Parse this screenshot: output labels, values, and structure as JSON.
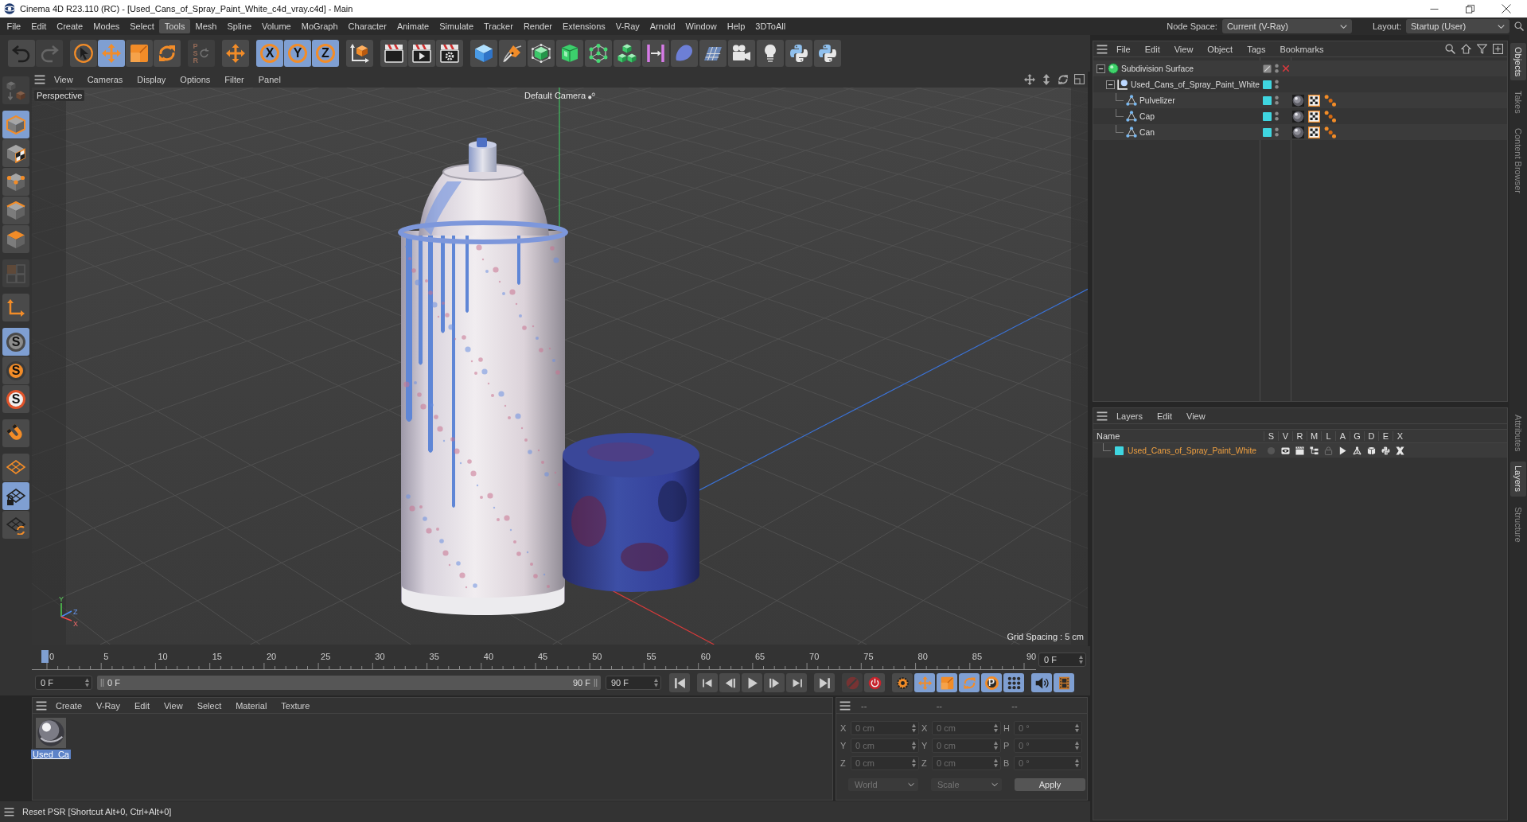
{
  "window": {
    "title": "Cinema 4D R23.110 (RC) - [Used_Cans_of_Spray_Paint_White_c4d_vray.c4d] - Main"
  },
  "menu_bar": {
    "items": [
      {
        "label": "File",
        "selected": false
      },
      {
        "label": "Edit",
        "selected": false
      },
      {
        "label": "Create",
        "selected": false
      },
      {
        "label": "Modes",
        "selected": false
      },
      {
        "label": "Select",
        "selected": false
      },
      {
        "label": "Tools",
        "selected": true
      },
      {
        "label": "Mesh",
        "selected": false
      },
      {
        "label": "Spline",
        "selected": false
      },
      {
        "label": "Volume",
        "selected": false
      },
      {
        "label": "MoGraph",
        "selected": false
      },
      {
        "label": "Character",
        "selected": false
      },
      {
        "label": "Animate",
        "selected": false
      },
      {
        "label": "Simulate",
        "selected": false
      },
      {
        "label": "Tracker",
        "selected": false
      },
      {
        "label": "Render",
        "selected": false
      },
      {
        "label": "Extensions",
        "selected": false
      },
      {
        "label": "V-Ray",
        "selected": false
      },
      {
        "label": "Arnold",
        "selected": false
      },
      {
        "label": "Window",
        "selected": false
      },
      {
        "label": "Help",
        "selected": false
      },
      {
        "label": "3DToAll",
        "selected": false
      }
    ],
    "node_space": {
      "label": "Node Space:",
      "value": "Current (V-Ray)"
    },
    "layout": {
      "label": "Layout:",
      "value": "Startup (User)"
    }
  },
  "toolbar": {
    "groups": [
      [
        {
          "kind": "undo",
          "selected": false,
          "disabled": false
        },
        {
          "kind": "redo",
          "selected": false,
          "disabled": true
        }
      ],
      [
        {
          "kind": "select",
          "selected": false,
          "disabled": false
        },
        {
          "kind": "move",
          "selected": true,
          "disabled": false
        },
        {
          "kind": "scale",
          "selected": false,
          "disabled": false
        },
        {
          "kind": "rotate",
          "selected": false,
          "disabled": false
        }
      ],
      [
        {
          "kind": "psr",
          "label": "PSR",
          "selected": false,
          "disabled": true
        }
      ],
      [
        {
          "kind": "axis_move",
          "selected": false,
          "disabled": false
        }
      ],
      [
        {
          "kind": "axis",
          "label": "X",
          "selected": true,
          "disabled": false
        },
        {
          "kind": "axis",
          "label": "Y",
          "selected": true,
          "disabled": false
        },
        {
          "kind": "axis",
          "label": "Z",
          "selected": true,
          "disabled": false
        }
      ],
      [
        {
          "kind": "coords",
          "selected": false,
          "disabled": false
        }
      ],
      [
        {
          "kind": "render_view",
          "selected": false,
          "disabled": false
        },
        {
          "kind": "render",
          "selected": false,
          "disabled": false
        },
        {
          "kind": "render_settings",
          "selected": false,
          "disabled": false
        }
      ],
      [
        {
          "kind": "cube",
          "selected": false,
          "disabled": false
        },
        {
          "kind": "pen",
          "selected": false,
          "disabled": false
        },
        {
          "kind": "subdivision",
          "selected": false,
          "disabled": false
        },
        {
          "kind": "box",
          "selected": false,
          "disabled": false
        },
        {
          "kind": "nodes",
          "selected": false,
          "disabled": false
        },
        {
          "kind": "cubes",
          "selected": false,
          "disabled": false
        },
        {
          "kind": "bars",
          "selected": false,
          "disabled": false
        },
        {
          "kind": "deformer",
          "selected": false,
          "disabled": false
        },
        {
          "kind": "floor",
          "selected": false,
          "disabled": false
        },
        {
          "kind": "camera",
          "selected": false,
          "disabled": false
        },
        {
          "kind": "light",
          "selected": false,
          "disabled": false
        },
        {
          "kind": "python",
          "selected": false,
          "disabled": false
        },
        {
          "kind": "python",
          "selected": false,
          "disabled": false
        }
      ]
    ]
  },
  "tool_palette": {
    "groups": [
      [
        {
          "kind": "make_editable",
          "selected": false,
          "disabled": true
        }
      ],
      [
        {
          "kind": "model",
          "selected": true,
          "disabled": false
        },
        {
          "kind": "texture",
          "selected": false,
          "disabled": false
        },
        {
          "kind": "points",
          "selected": false,
          "disabled": false
        },
        {
          "kind": "edges",
          "selected": false,
          "disabled": false
        },
        {
          "kind": "polygons",
          "selected": false,
          "disabled": false
        }
      ],
      [
        {
          "kind": "enable_axis",
          "selected": false,
          "disabled": true
        }
      ],
      [
        {
          "kind": "workplane",
          "selected": false,
          "disabled": false
        }
      ],
      [
        {
          "kind": "snap",
          "label": "S",
          "selected": true,
          "disabled": false
        },
        {
          "kind": "snap_solid",
          "label": "S",
          "selected": false,
          "disabled": false
        },
        {
          "kind": "snap_ring",
          "label": "S",
          "selected": false,
          "disabled": false
        }
      ],
      [
        {
          "kind": "magnet",
          "selected": false,
          "disabled": false
        }
      ],
      [
        {
          "kind": "grid_solid",
          "selected": false,
          "disabled": false
        },
        {
          "kind": "grid_lock",
          "selected": true,
          "disabled": false
        },
        {
          "kind": "grid_rotate",
          "selected": false,
          "disabled": false
        }
      ]
    ]
  },
  "viewport": {
    "menu": [
      "View",
      "Cameras",
      "Display",
      "Options",
      "Filter",
      "Panel"
    ],
    "view_name": "Perspective",
    "camera": "Default Camera",
    "grid_spacing": "Grid Spacing : 5 cm",
    "axis_labels": [
      "Y",
      "Z",
      "X"
    ]
  },
  "timeline": {
    "ticks": [
      "0",
      "5",
      "10",
      "15",
      "20",
      "25",
      "30",
      "35",
      "40",
      "45",
      "50",
      "55",
      "60",
      "65",
      "70",
      "75",
      "80",
      "85",
      "90"
    ],
    "level": 0,
    "current_frame": "0 F",
    "start_field": "0 F",
    "range_start": "0 F",
    "range_end": "90 F",
    "end_field": "90 F",
    "controls": [
      [
        {
          "kind": "first",
          "selected": false,
          "disabled": false
        }
      ],
      [
        {
          "kind": "prev_key",
          "selected": false,
          "disabled": false
        },
        {
          "kind": "prev_frame",
          "selected": false,
          "disabled": false
        },
        {
          "kind": "play",
          "selected": false,
          "disabled": false
        },
        {
          "kind": "next_frame",
          "selected": false,
          "disabled": false
        },
        {
          "kind": "next_key",
          "selected": false,
          "disabled": false
        }
      ],
      [
        {
          "kind": "last",
          "selected": false,
          "disabled": false
        }
      ],
      [
        {
          "kind": "record",
          "selected": false,
          "disabled": true
        },
        {
          "kind": "autokey",
          "selected": false,
          "disabled": false
        }
      ],
      [
        {
          "kind": "key_select",
          "selected": false,
          "disabled": false
        },
        {
          "kind": "key_pos",
          "selected": true,
          "disabled": false
        },
        {
          "kind": "key_scale",
          "selected": true,
          "disabled": false
        },
        {
          "kind": "key_rot",
          "selected": true,
          "disabled": false
        },
        {
          "kind": "key_param",
          "label": "P",
          "selected": true,
          "disabled": false
        },
        {
          "kind": "key_points",
          "selected": true,
          "disabled": false
        }
      ],
      [
        {
          "kind": "sound",
          "selected": true,
          "disabled": false
        },
        {
          "kind": "film",
          "selected": true,
          "disabled": false
        }
      ]
    ]
  },
  "material_manager": {
    "menu": [
      "Create",
      "V-Ray",
      "Edit",
      "View",
      "Select",
      "Material",
      "Texture"
    ],
    "materials": [
      {
        "name": "Used_Ca",
        "selected": true
      }
    ]
  },
  "coordinates": {
    "disabled": true,
    "headers": [
      "--",
      "--",
      "--"
    ],
    "rows": [
      {
        "labels": [
          "X",
          "X",
          "H"
        ],
        "values": [
          "0 cm",
          "0 cm",
          "0 °"
        ]
      },
      {
        "labels": [
          "Y",
          "Y",
          "P"
        ],
        "values": [
          "0 cm",
          "0 cm",
          "0 °"
        ]
      },
      {
        "labels": [
          "Z",
          "Z",
          "B"
        ],
        "values": [
          "0 cm",
          "0 cm",
          "0 °"
        ]
      }
    ],
    "space": "World",
    "mode": "Scale",
    "apply": "Apply"
  },
  "status_bar": {
    "text": "Reset PSR [Shortcut Alt+0, Ctrl+Alt+0]"
  },
  "object_manager": {
    "menu": [
      "File",
      "Edit",
      "View",
      "Object",
      "Tags",
      "Bookmarks"
    ],
    "objects": [
      {
        "name": "Subdivision Surface",
        "kind": "generator",
        "expanded": true,
        "enabled": false,
        "children": [
          {
            "name": "Used_Cans_of_Spray_Paint_White",
            "kind": "null",
            "expanded": true,
            "color": "#3fd6e0",
            "children": [
              {
                "name": "Pulvelizer",
                "kind": "polygon",
                "color": "#3fd6e0",
                "tags": [
                  {
                    "kind": "material"
                  },
                  {
                    "kind": "uvw"
                  },
                  {
                    "kind": "points"
                  }
                ]
              },
              {
                "name": "Cap",
                "kind": "polygon",
                "color": "#3fd6e0",
                "tags": [
                  {
                    "kind": "material"
                  },
                  {
                    "kind": "uvw"
                  },
                  {
                    "kind": "points"
                  }
                ]
              },
              {
                "name": "Can",
                "kind": "polygon",
                "color": "#3fd6e0",
                "tags": [
                  {
                    "kind": "material"
                  },
                  {
                    "kind": "uvw"
                  },
                  {
                    "kind": "points"
                  }
                ]
              }
            ]
          }
        ]
      }
    ]
  },
  "layer_manager": {
    "menu": [
      "Layers",
      "Edit",
      "View"
    ],
    "name_column": "Name",
    "columns": [
      {
        "label": "S",
        "kind": "solo"
      },
      {
        "label": "V",
        "kind": "view"
      },
      {
        "label": "R",
        "kind": "render"
      },
      {
        "label": "M",
        "kind": "manager"
      },
      {
        "label": "L",
        "kind": "lock"
      },
      {
        "label": "A",
        "kind": "animation"
      },
      {
        "label": "G",
        "kind": "generators"
      },
      {
        "label": "D",
        "kind": "deformers"
      },
      {
        "label": "E",
        "kind": "expressions"
      },
      {
        "label": "X",
        "kind": "xrefs"
      }
    ],
    "layers": [
      {
        "name": "Used_Cans_of_Spray_Paint_White",
        "color": "#3fd6e0",
        "flags": [
          false,
          true,
          true,
          true,
          false,
          true,
          true,
          true,
          true,
          true
        ]
      }
    ]
  },
  "side_tabs": {
    "top": [
      {
        "label": "Objects",
        "selected": true
      },
      {
        "label": "Takes",
        "selected": false
      },
      {
        "label": "Content Browser",
        "selected": false
      }
    ],
    "bottom": [
      {
        "label": "Attributes",
        "selected": false
      },
      {
        "label": "Layers",
        "selected": true
      },
      {
        "label": "Structure",
        "selected": false
      }
    ]
  }
}
